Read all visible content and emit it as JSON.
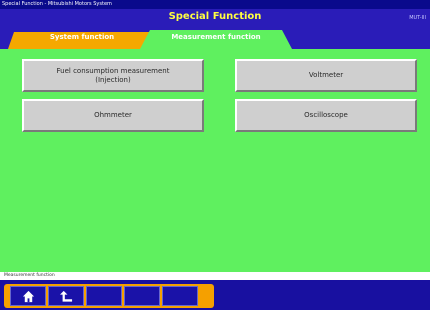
{
  "window": {
    "title": "Special Function - Mitsubishi Motors System",
    "header_title": "Special Function",
    "header_right": "MUT-III"
  },
  "tabs": [
    {
      "label": "System function",
      "color": "#f5a800",
      "active": false
    },
    {
      "label": "Measurement function",
      "color": "#5ff05f",
      "active": true
    }
  ],
  "functions": {
    "fuel_consumption": "Fuel consumption measurement\n(Injection)",
    "voltmeter": "Voltmeter",
    "ohmmeter": "Ohmmeter",
    "oscilloscope": "Oscilloscope"
  },
  "status_bar": {
    "text": "Measurement function"
  },
  "bottom_toolbar": {
    "buttons": [
      {
        "icon": "home-icon"
      },
      {
        "icon": "back-icon"
      },
      {
        "icon": ""
      },
      {
        "icon": ""
      },
      {
        "icon": ""
      }
    ]
  },
  "colors": {
    "background": "#1810a0",
    "panel_green": "#5ff05f",
    "accent_orange": "#f5a800",
    "title_yellow": "#ffff40"
  }
}
